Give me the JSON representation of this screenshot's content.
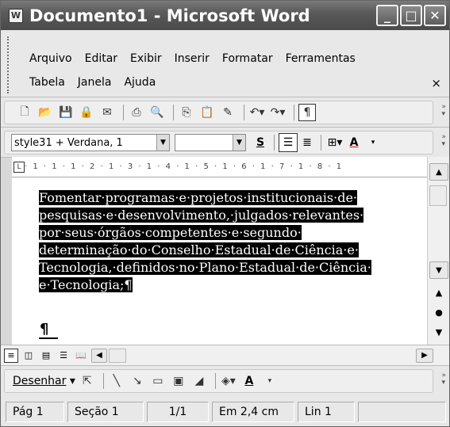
{
  "window": {
    "title": "Documento1 - Microsoft Word",
    "app_icon": "word-doc-icon",
    "controls": [
      "minimize-icon",
      "maximize-icon",
      "close-icon"
    ]
  },
  "menubar": {
    "row1": [
      "Arquivo",
      "Editar",
      "Exibir",
      "Inserir",
      "Formatar",
      "Ferramentas"
    ],
    "row2": [
      "Tabela",
      "Janela",
      "Ajuda"
    ],
    "close": "×"
  },
  "standard_toolbar": {
    "icons": [
      "new-icon",
      "open-icon",
      "save-icon",
      "permission-icon",
      "email-icon",
      "print-icon",
      "print-preview-icon",
      "copy-icon",
      "paste-icon",
      "format-painter-icon",
      "undo-icon",
      "redo-icon",
      "show-formatting-icon"
    ]
  },
  "formatting_toolbar": {
    "style_value": "style31 + Verdana, 1",
    "font_value": "",
    "strike_label": "S",
    "font_color_label": "A"
  },
  "ruler": {
    "marks": "· 1 · 1 · 1 · 2 · 1 · 3 · 1 · 4 · 1 · 5 · 1 · 6 · 1 · 7 · 1 · 8 · 1"
  },
  "document": {
    "lines": [
      "Fomentar·programas·e·projetos·institucionais·de·",
      "pesquisas·e·desenvolvimento,·julgados·relevantes·",
      "por·seus·órgãos·competentes·e·segundo·",
      "determinação·do·Conselho·Estadual·de·Ciência·e·",
      "Tecnologia,·definidos·no·Plano·Estadual·de·Ciência·",
      "e·Tecnologia;¶"
    ],
    "empty_paragraph": "¶"
  },
  "draw_toolbar": {
    "draw_label": "Desenhar",
    "font_color_label": "A"
  },
  "status": {
    "page": "Pág 1",
    "section": "Seção 1",
    "pages": "1/1",
    "position": "Em 2,4 cm",
    "line": "Lin 1"
  }
}
